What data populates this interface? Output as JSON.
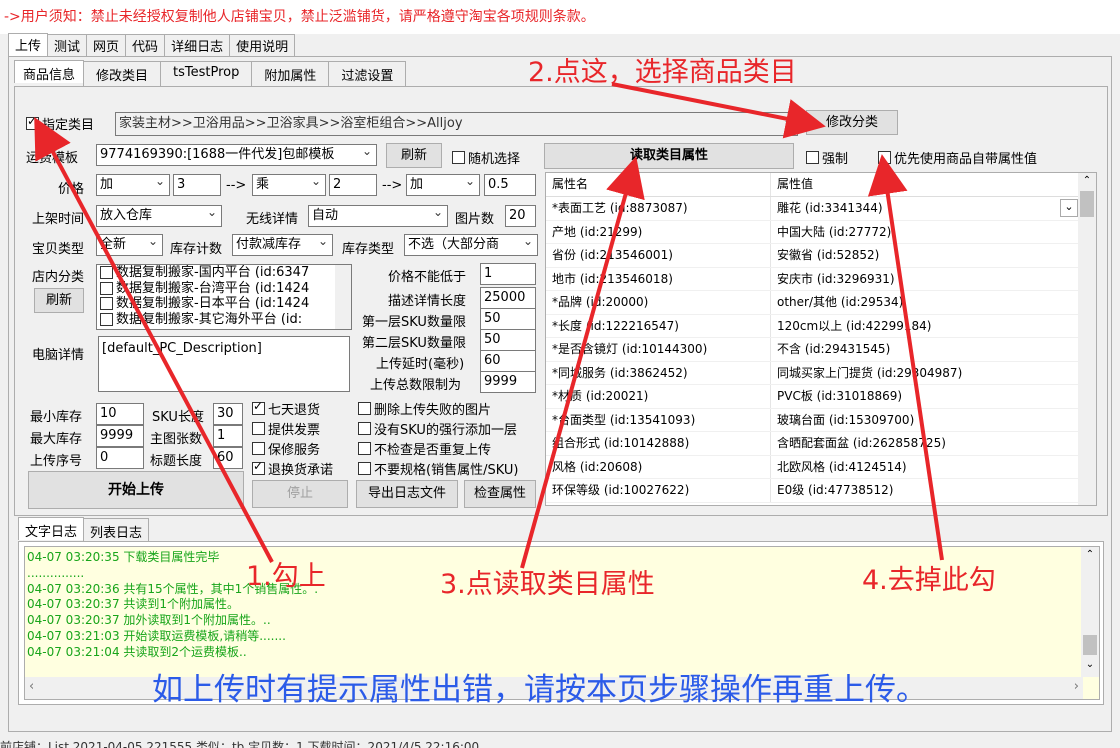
{
  "notice": "->用户须知：禁止未经授权复制他人店铺宝贝，禁止泛滥铺货，请严格遵守淘宝各项规则条款。",
  "main_tabs": [
    "上传",
    "测试",
    "网页",
    "代码",
    "详细日志",
    "使用说明"
  ],
  "sub_tabs": [
    "商品信息",
    "修改类目",
    "tsTestProp",
    "附加属性",
    "过滤设置"
  ],
  "category": {
    "checkbox_label": "指定类目",
    "path": "家装主材>>卫浴用品>>卫浴家具>>浴室柜组合>>Alljoy",
    "modify_button": "修改分类"
  },
  "shipping": {
    "label": "运费模板",
    "value": "9774169390:[1688一件代发]包邮模板",
    "refresh_button": "刷新",
    "random_label": "随机选择"
  },
  "read_attrs_button": "读取类目属性",
  "force_label": "强制",
  "prefer_label": "优先使用商品自带属性值",
  "price": {
    "label": "价格",
    "op1": "加",
    "v1": "3",
    "arrow1": "-->",
    "op2": "乘",
    "v2": "2",
    "arrow2": "-->",
    "op3": "加",
    "v3": "0.5"
  },
  "listing": {
    "label": "上架时间",
    "value": "放入仓库",
    "wireless_label": "无线详情",
    "wireless_value": "自动",
    "img_label": "图片数",
    "img_count": "20"
  },
  "item_type": {
    "label": "宝贝类型",
    "value": "全新",
    "stock_label": "库存计数",
    "stock_value": "付款减库存",
    "stock_type_label": "库存类型",
    "stock_type_value": "不选（大部分商"
  },
  "shop_cat": {
    "label": "店内分类",
    "refresh_button": "刷新",
    "items": [
      "数据复制搬家-国内平台 (id:6347",
      "数据复制搬家-台湾平台 (id:1424",
      "数据复制搬家-日本平台 (id:1424",
      "数据复制搬家-其它海外平台 (id:"
    ]
  },
  "limits": [
    {
      "label": "价格不能低于",
      "value": "1"
    },
    {
      "label": "描述详情长度",
      "value": "25000"
    },
    {
      "label": "第一层SKU数量限",
      "value": "50"
    },
    {
      "label": "第二层SKU数量限",
      "value": "50"
    },
    {
      "label": "上传延时(毫秒)",
      "value": "60"
    },
    {
      "label": "上传总数限制为",
      "value": "9999"
    }
  ],
  "pc_detail": {
    "label": "电脑详情",
    "value": "[default_PC_Description]"
  },
  "stock": {
    "min_label": "最小库存",
    "min": "10",
    "max_label": "最大库存",
    "max": "9999",
    "seq_label": "上传序号",
    "seq": "0"
  },
  "sku": {
    "len_label": "SKU长度",
    "len": "30",
    "img_label": "主图张数",
    "img": "1",
    "title_label": "标题长度",
    "title": "60"
  },
  "checks_mid": [
    {
      "label": "七天退货",
      "checked": true
    },
    {
      "label": "提供发票",
      "checked": false
    },
    {
      "label": "保修服务",
      "checked": false
    },
    {
      "label": "退换货承诺",
      "checked": true
    }
  ],
  "checks_right": [
    {
      "label": "删除上传失败的图片",
      "checked": false
    },
    {
      "label": "没有SKU的强行添加一层",
      "checked": false
    },
    {
      "label": "不检查是否重复上传",
      "checked": false
    },
    {
      "label": "不要规格(销售属性/SKU)",
      "checked": false
    }
  ],
  "start_button": "开始上传",
  "stop_button": "停止",
  "export_button": "导出日志文件",
  "check_button": "检查属性",
  "attr_table": {
    "col1": "属性名",
    "col2": "属性值",
    "rows": [
      [
        "*表面工艺 (id:8873087)",
        "雕花 (id:3341344)"
      ],
      [
        "产地 (id:21299)",
        "中国大陆 (id:27772)"
      ],
      [
        "省份 (id:213546001)",
        "安徽省 (id:52852)"
      ],
      [
        "地市 (id:213546018)",
        "安庆市 (id:3296931)"
      ],
      [
        "*品牌 (id:20000)",
        "other/其他 (id:29534)"
      ],
      [
        "*长度 (id:122216547)",
        "120cm以上 (id:42299184)"
      ],
      [
        "*是否含镜灯 (id:10144300)",
        "不含 (id:29431545)"
      ],
      [
        "*同城服务 (id:3862452)",
        "同城买家上门提货 (id:29304987)"
      ],
      [
        "*材质 (id:20021)",
        "PVC板 (id:31018869)"
      ],
      [
        "*台面类型 (id:13541093)",
        "玻璃台面 (id:15309700)"
      ],
      [
        "组合形式 (id:10142888)",
        "含晒配套面盆 (id:262858725)"
      ],
      [
        "风格 (id:20608)",
        "北欧风格 (id:4124514)"
      ],
      [
        "环保等级 (id:10027622)",
        "E0级 (id:47738512)"
      ]
    ]
  },
  "log_tabs": [
    "文字日志",
    "列表日志"
  ],
  "log_lines": [
    "04-07 03:20:35  下载类目属性完毕",
    "...............",
    "04-07 03:20:36  共有15个属性，其中1个销售属性。.",
    "04-07 03:20:37  共读到1个附加属性。",
    "04-07 03:20:37  加外读取到1个附加属性。..",
    "04-07 03:21:03  开始读取运费模板,请稍等.......",
    "04-07 03:21:04  共读取到2个运费模板.."
  ],
  "status_bar": "前店铺：List 2021-04-05 221555    类似：tb    宝贝数：1    下载时间：2021/4/5 22:16:00",
  "annotations": {
    "step1": "1.勾上",
    "step2": "2.点这，选择商品类目",
    "step3": "3.点读取类目属性",
    "step4": "4.去掉此勾",
    "footer": "如上传时有提示属性出错，请按本页步骤操作再重上传。"
  },
  "colors": {
    "annotation": "#e8262a",
    "footer": "#2b5be8",
    "log_text": "#18a51a",
    "log_bg": "#ffffe0"
  }
}
